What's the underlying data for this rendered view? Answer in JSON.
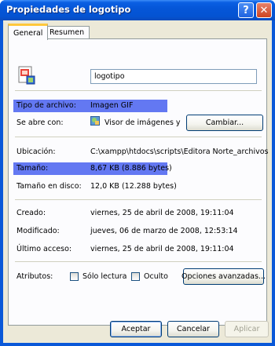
{
  "window": {
    "title": "Propiedades de logotipo",
    "help_glyph": "?",
    "close_glyph": "✕"
  },
  "tabs": [
    {
      "label": "General",
      "active": true
    },
    {
      "label": "Resumen",
      "active": false
    }
  ],
  "file": {
    "name": "logotipo",
    "icon": "gif-image-icon"
  },
  "type": {
    "label": "Tipo de archivo:",
    "value": "Imagen GIF"
  },
  "opens_with": {
    "label": "Se abre con:",
    "value": "Visor de imágenes y",
    "icon": "image-viewer-icon",
    "change_button": "Cambiar..."
  },
  "location": {
    "label": "Ubicación:",
    "value": "C:\\xampp\\htdocs\\scripts\\Editora Norte_archivos"
  },
  "size": {
    "label": "Tamaño:",
    "value": "8,67 KB (8.886 bytes)"
  },
  "size_on_disk": {
    "label": "Tamaño en disco:",
    "value": "12,0 KB (12.288 bytes)"
  },
  "created": {
    "label": "Creado:",
    "value": "viernes, 25 de abril de 2008, 19:11:04"
  },
  "modified": {
    "label": "Modificado:",
    "value": "jueves, 06 de marzo de 2008, 12:53:14"
  },
  "accessed": {
    "label": "Último acceso:",
    "value": "viernes, 25 de abril de 2008, 19:11:04"
  },
  "attributes": {
    "label": "Atributos:",
    "readonly": {
      "label": "Sólo lectura",
      "checked": false
    },
    "hidden": {
      "label": "Oculto",
      "checked": false
    },
    "advanced_button": "Opciones avanzadas..."
  },
  "footer": {
    "ok": "Aceptar",
    "cancel": "Cancelar",
    "apply": "Aplicar"
  },
  "colors": {
    "highlight": "#6378f2",
    "titlebar": "#0556d8",
    "dialog_bg": "#ece9d8"
  }
}
